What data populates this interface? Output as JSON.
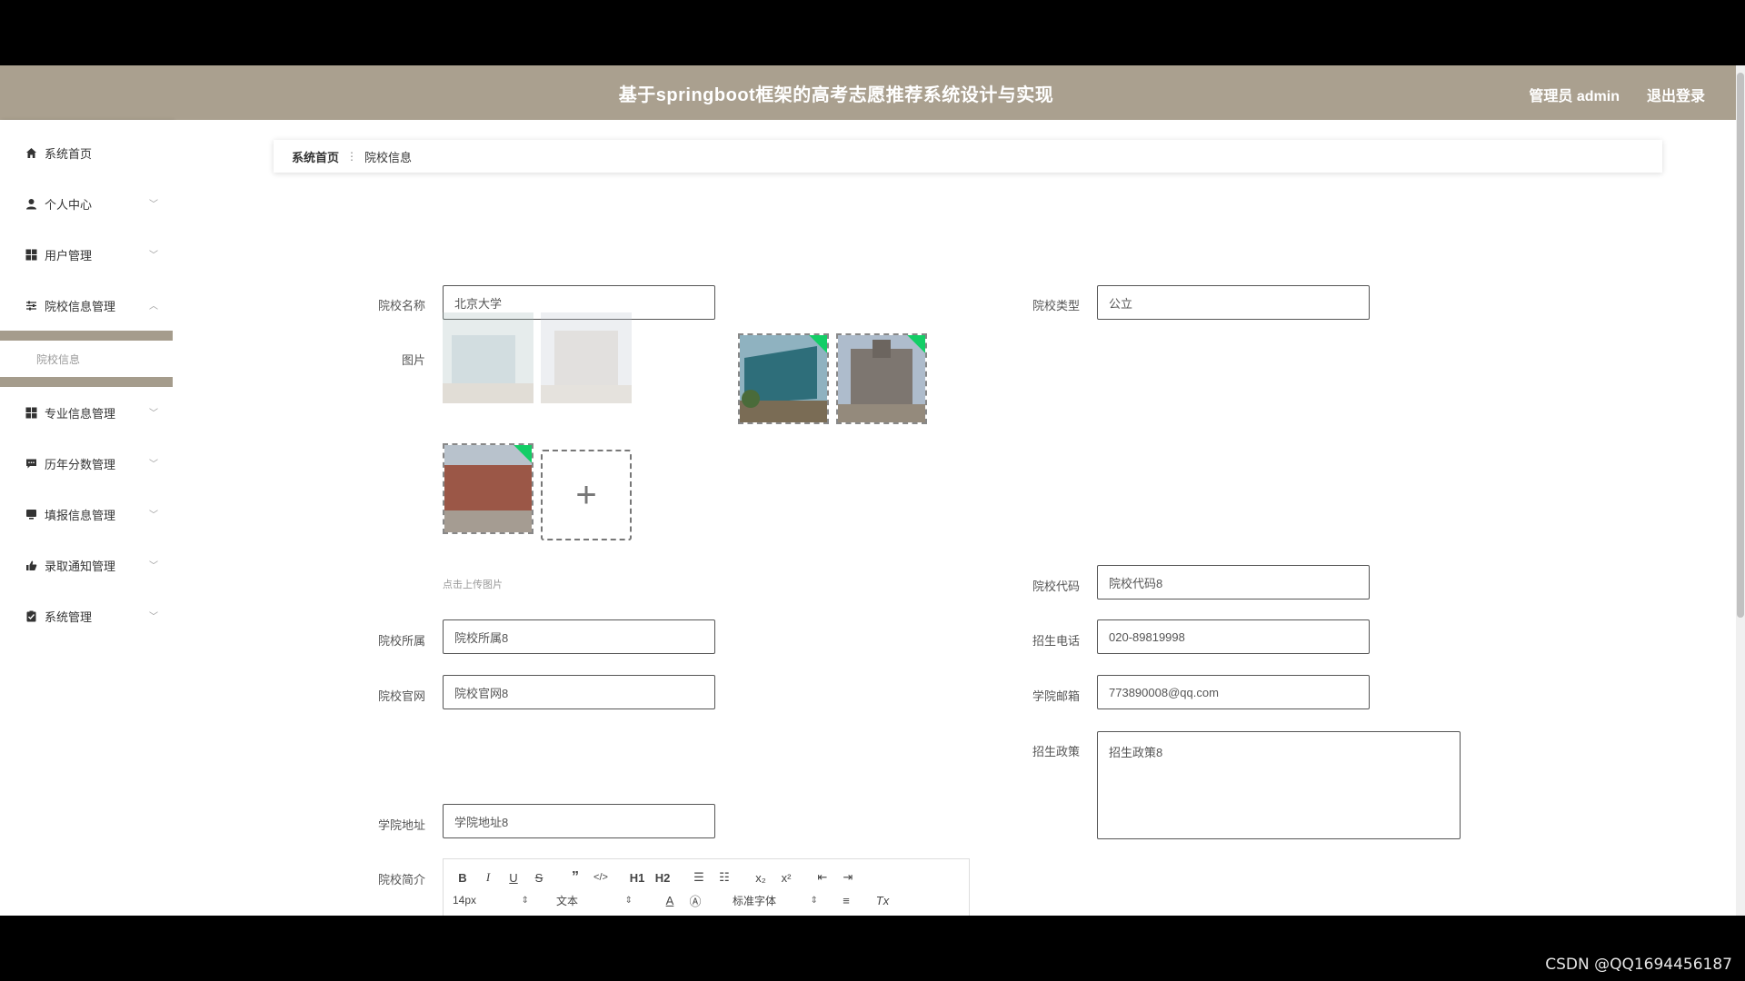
{
  "header": {
    "title": "基于springboot框架的高考志愿推荐系统设计与实现",
    "user": "管理员 admin",
    "logout": "退出登录"
  },
  "sidebar": {
    "items": [
      {
        "label": "系统首页",
        "icon": "home-icon"
      },
      {
        "label": "个人中心",
        "icon": "user-icon"
      },
      {
        "label": "用户管理",
        "icon": "grid-icon"
      },
      {
        "label": "院校信息管理",
        "icon": "sliders-icon"
      },
      {
        "label": "专业信息管理",
        "icon": "grid-icon"
      },
      {
        "label": "历年分数管理",
        "icon": "message-icon"
      },
      {
        "label": "填报信息管理",
        "icon": "monitor-icon"
      },
      {
        "label": "录取通知管理",
        "icon": "thumb-icon"
      },
      {
        "label": "系统管理",
        "icon": "clipboard-icon"
      }
    ],
    "submenu_active": "院校信息"
  },
  "breadcrumb": {
    "home": "系统首页",
    "current": "院校信息"
  },
  "form": {
    "name_label": "院校名称",
    "name_value": "北京大学",
    "type_label": "院校类型",
    "type_value": "公立",
    "image_label": "图片",
    "upload_hint": "点击上传图片",
    "code_label": "院校代码",
    "code_value": "院校代码8",
    "affiliation_label": "院校所属",
    "affiliation_value": "院校所属8",
    "phone_label": "招生电话",
    "phone_value": "020-89819998",
    "website_label": "院校官网",
    "website_value": "院校官网8",
    "email_label": "学院邮箱",
    "email_value": "773890008@qq.com",
    "policy_label": "招生政策",
    "policy_value": "招生政策8",
    "address_label": "学院地址",
    "address_value": "学院地址8",
    "intro_label": "院校简介"
  },
  "editor": {
    "font_size": "14px",
    "text_type": "文本",
    "font_family": "标准字体",
    "h1": "H1",
    "h2": "H2"
  },
  "watermark": "CSDN @QQ1694456187"
}
